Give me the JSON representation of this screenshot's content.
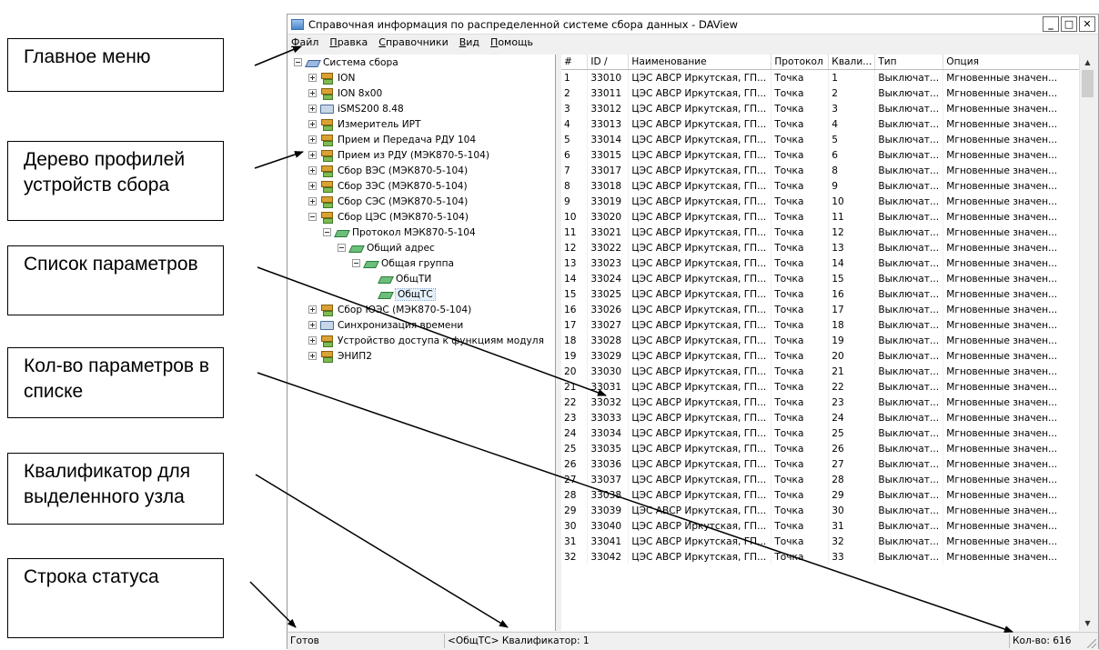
{
  "callouts": {
    "main_menu": "Главное меню",
    "tree": "Дерево профилей устройств сбора",
    "param_list": "Список параметров",
    "param_count": "Кол-во параметров в списке",
    "qualifier": "Квалификатор для выделенного узла",
    "status_bar": "Строка статуса"
  },
  "window": {
    "title": "Справочная информация по распределенной системе сбора данных - DAView",
    "buttons": {
      "minimize": "_",
      "maximize": "□",
      "close": "✕"
    }
  },
  "menu": [
    {
      "key": "Ф",
      "rest": "айл"
    },
    {
      "key": "П",
      "rest": "равка"
    },
    {
      "key": "С",
      "rest": "правочники"
    },
    {
      "key": "В",
      "rest": "ид"
    },
    {
      "key": "П",
      "rest": "омощь"
    }
  ],
  "tree": [
    {
      "label": "Система сбора",
      "level": 0,
      "expander": "minus",
      "icon": "system-icon"
    },
    {
      "label": "ION",
      "level": 1,
      "expander": "plus",
      "icon": "device-icon"
    },
    {
      "label": "ION 8x00",
      "level": 1,
      "expander": "plus",
      "icon": "device-icon"
    },
    {
      "label": "iSMS200 8.48",
      "level": 1,
      "expander": "plus",
      "icon": "computer-icon"
    },
    {
      "label": "Измеритель ИРТ",
      "level": 1,
      "expander": "plus",
      "icon": "device-icon"
    },
    {
      "label": "Прием и Передача РДУ 104",
      "level": 1,
      "expander": "plus",
      "icon": "device-icon"
    },
    {
      "label": "Прием из РДУ (МЭК870-5-104)",
      "level": 1,
      "expander": "plus",
      "icon": "device-icon"
    },
    {
      "label": "Сбор ВЭС (МЭК870-5-104)",
      "level": 1,
      "expander": "plus",
      "icon": "device-icon"
    },
    {
      "label": "Сбор ЗЭС (МЭК870-5-104)",
      "level": 1,
      "expander": "plus",
      "icon": "device-icon"
    },
    {
      "label": "Сбор СЭС (МЭК870-5-104)",
      "level": 1,
      "expander": "plus",
      "icon": "device-icon"
    },
    {
      "label": "Сбор ЦЭС (МЭК870-5-104)",
      "level": 1,
      "expander": "minus",
      "icon": "device-icon"
    },
    {
      "label": "Протокол МЭК870-5-104",
      "level": 2,
      "expander": "minus",
      "icon": "plate-icon"
    },
    {
      "label": "Общий адрес",
      "level": 3,
      "expander": "minus",
      "icon": "plate-icon"
    },
    {
      "label": "Общая группа",
      "level": 4,
      "expander": "minus",
      "icon": "plate-icon"
    },
    {
      "label": "ОбщТИ",
      "level": 5,
      "expander": "none",
      "icon": "plate-icon"
    },
    {
      "label": "ОбщТС",
      "level": 5,
      "expander": "none",
      "icon": "plate-icon",
      "selected": true
    },
    {
      "label": "Сбор ЮЭС (МЭК870-5-104)",
      "level": 1,
      "expander": "plus",
      "icon": "device-icon"
    },
    {
      "label": "Синхронизация времени",
      "level": 1,
      "expander": "plus",
      "icon": "computer-icon"
    },
    {
      "label": "Устройство доступа к функциям модуля",
      "level": 1,
      "expander": "plus",
      "icon": "device-icon"
    },
    {
      "label": "ЭНИП2",
      "level": 1,
      "expander": "plus",
      "icon": "device-icon"
    }
  ],
  "table": {
    "columns": [
      "#",
      "ID  /",
      "Наименование",
      "Протокол",
      "Квали...",
      "Тип",
      "Опция"
    ],
    "rows": [
      [
        "1",
        "33010",
        "ЦЭС АВСР Иркутская, ГП...",
        "Точка",
        "1",
        "Выключат...",
        "Мгновенные значен..."
      ],
      [
        "2",
        "33011",
        "ЦЭС АВСР Иркутская, ГП...",
        "Точка",
        "2",
        "Выключат...",
        "Мгновенные значен..."
      ],
      [
        "3",
        "33012",
        "ЦЭС АВСР Иркутская, ГП...",
        "Точка",
        "3",
        "Выключат...",
        "Мгновенные значен..."
      ],
      [
        "4",
        "33013",
        "ЦЭС АВСР Иркутская, ГП...",
        "Точка",
        "4",
        "Выключат...",
        "Мгновенные значен..."
      ],
      [
        "5",
        "33014",
        "ЦЭС АВСР Иркутская, ГП...",
        "Точка",
        "5",
        "Выключат...",
        "Мгновенные значен..."
      ],
      [
        "6",
        "33015",
        "ЦЭС АВСР Иркутская, ГП...",
        "Точка",
        "6",
        "Выключат...",
        "Мгновенные значен..."
      ],
      [
        "7",
        "33017",
        "ЦЭС АВСР Иркутская, ГП...",
        "Точка",
        "8",
        "Выключат...",
        "Мгновенные значен..."
      ],
      [
        "8",
        "33018",
        "ЦЭС АВСР Иркутская, ГП...",
        "Точка",
        "9",
        "Выключат...",
        "Мгновенные значен..."
      ],
      [
        "9",
        "33019",
        "ЦЭС АВСР Иркутская, ГП...",
        "Точка",
        "10",
        "Выключат...",
        "Мгновенные значен..."
      ],
      [
        "10",
        "33020",
        "ЦЭС АВСР Иркутская, ГП...",
        "Точка",
        "11",
        "Выключат...",
        "Мгновенные значен..."
      ],
      [
        "11",
        "33021",
        "ЦЭС АВСР Иркутская, ГП...",
        "Точка",
        "12",
        "Выключат...",
        "Мгновенные значен..."
      ],
      [
        "12",
        "33022",
        "ЦЭС АВСР Иркутская, ГП...",
        "Точка",
        "13",
        "Выключат...",
        "Мгновенные значен..."
      ],
      [
        "13",
        "33023",
        "ЦЭС АВСР Иркутская, ГП...",
        "Точка",
        "14",
        "Выключат...",
        "Мгновенные значен..."
      ],
      [
        "14",
        "33024",
        "ЦЭС АВСР Иркутская, ГП...",
        "Точка",
        "15",
        "Выключат...",
        "Мгновенные значен..."
      ],
      [
        "15",
        "33025",
        "ЦЭС АВСР Иркутская, ГП...",
        "Точка",
        "16",
        "Выключат...",
        "Мгновенные значен..."
      ],
      [
        "16",
        "33026",
        "ЦЭС АВСР Иркутская, ГП...",
        "Точка",
        "17",
        "Выключат...",
        "Мгновенные значен..."
      ],
      [
        "17",
        "33027",
        "ЦЭС АВСР Иркутская, ГП...",
        "Точка",
        "18",
        "Выключат...",
        "Мгновенные значен..."
      ],
      [
        "18",
        "33028",
        "ЦЭС АВСР Иркутская, ГП...",
        "Точка",
        "19",
        "Выключат...",
        "Мгновенные значен..."
      ],
      [
        "19",
        "33029",
        "ЦЭС АВСР Иркутская, ГП...",
        "Точка",
        "20",
        "Выключат...",
        "Мгновенные значен..."
      ],
      [
        "20",
        "33030",
        "ЦЭС АВСР Иркутская, ГП...",
        "Точка",
        "21",
        "Выключат...",
        "Мгновенные значен..."
      ],
      [
        "21",
        "33031",
        "ЦЭС АВСР Иркутская, ГП...",
        "Точка",
        "22",
        "Выключат...",
        "Мгновенные значен..."
      ],
      [
        "22",
        "33032",
        "ЦЭС АВСР Иркутская, ГП...",
        "Точка",
        "23",
        "Выключат...",
        "Мгновенные значен..."
      ],
      [
        "23",
        "33033",
        "ЦЭС АВСР Иркутская, ГП...",
        "Точка",
        "24",
        "Выключат...",
        "Мгновенные значен..."
      ],
      [
        "24",
        "33034",
        "ЦЭС АВСР Иркутская, ГП...",
        "Точка",
        "25",
        "Выключат...",
        "Мгновенные значен..."
      ],
      [
        "25",
        "33035",
        "ЦЭС АВСР Иркутская, ГП...",
        "Точка",
        "26",
        "Выключат...",
        "Мгновенные значен..."
      ],
      [
        "26",
        "33036",
        "ЦЭС АВСР Иркутская, ГП...",
        "Точка",
        "27",
        "Выключат...",
        "Мгновенные значен..."
      ],
      [
        "27",
        "33037",
        "ЦЭС АВСР Иркутская, ГП...",
        "Точка",
        "28",
        "Выключат...",
        "Мгновенные значен..."
      ],
      [
        "28",
        "33038",
        "ЦЭС АВСР Иркутская, ГП...",
        "Точка",
        "29",
        "Выключат...",
        "Мгновенные значен..."
      ],
      [
        "29",
        "33039",
        "ЦЭС АВСР Иркутская, ГП...",
        "Точка",
        "30",
        "Выключат...",
        "Мгновенные значен..."
      ],
      [
        "30",
        "33040",
        "ЦЭС АВСР Иркутская, ГП...",
        "Точка",
        "31",
        "Выключат...",
        "Мгновенные значен..."
      ],
      [
        "31",
        "33041",
        "ЦЭС АВСР Иркутская, ГП...",
        "Точка",
        "32",
        "Выключат...",
        "Мгновенные значен..."
      ],
      [
        "32",
        "33042",
        "ЦЭС АВСР Иркутская, ГП...",
        "Точка",
        "33",
        "Выключат...",
        "Мгновенные значен..."
      ]
    ]
  },
  "status": {
    "ready": "Готов",
    "qualifier": "<ОбщТС> Квалификатор: 1",
    "count": "Кол-во: 616"
  }
}
